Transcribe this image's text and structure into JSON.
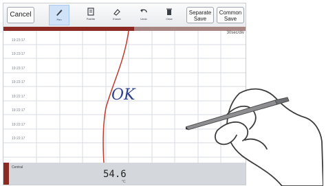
{
  "toolbar": {
    "cancel_label": "Cancel",
    "tools": [
      {
        "label": "Pen",
        "icon": "pen-icon"
      },
      {
        "label": "Palette",
        "icon": "palette-icon"
      },
      {
        "label": "Eraser",
        "icon": "eraser-icon"
      },
      {
        "label": "Undo",
        "icon": "undo-icon"
      },
      {
        "label": "Clear",
        "icon": "trash-icon"
      }
    ],
    "separate_save_line1": "Separate",
    "separate_save_line2": "Save",
    "common_save_line1": "Common",
    "common_save_line2": "Save"
  },
  "chart": {
    "speed_label": "30sec/div",
    "time_labels": [
      "19:23:17",
      "19:23:17",
      "19:23:17",
      "19:23:17",
      "19:22:17",
      "19:22:17",
      "19:22:17",
      "19:22:17"
    ],
    "annotation_text": "OK",
    "trace_color": "#c0392b",
    "header_color": "#8b2a22"
  },
  "bottom": {
    "label": "Central",
    "value": "54.6",
    "unit": "°C"
  }
}
